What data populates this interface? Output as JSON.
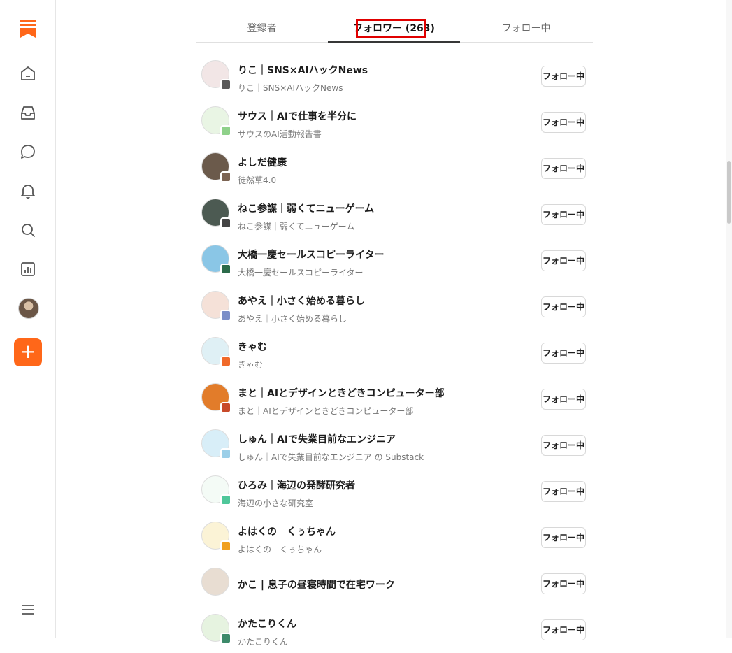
{
  "tabs": [
    {
      "label": "登録者"
    },
    {
      "label": "フォロワー (263)"
    },
    {
      "label": "フォロー中"
    }
  ],
  "colors": {
    "accent": "#ff6719",
    "highlight": "#e00000"
  },
  "icons": {
    "logo": "substack-logo-icon",
    "nav": [
      "home-icon",
      "inbox-icon",
      "chat-icon",
      "bell-icon",
      "search-icon",
      "stats-icon"
    ],
    "create": "plus-icon",
    "menu": "menu-icon"
  },
  "create_label": "+",
  "follow_label": "フォロー中",
  "followers": [
    {
      "name": "りこ｜SNS×AIハックNews",
      "sub": "りこ｜SNS×AIハックNews",
      "avatar_color": "#f2e6e6",
      "badge_color": "#5a5a5a"
    },
    {
      "name": "サウス｜AIで仕事を半分に",
      "sub": "サウスのAI活動報告書",
      "avatar_color": "#e9f5e4",
      "badge_color": "#8fd18a"
    },
    {
      "name": "よしだ健康",
      "sub": "徒然草4.0",
      "avatar_color": "#6b5a4b",
      "badge_color": "#7c6453"
    },
    {
      "name": "ねこ参謀｜弱くてニューゲーム",
      "sub": "ねこ参謀｜弱くてニューゲーム",
      "avatar_color": "#4c5a52",
      "badge_color": "#444"
    },
    {
      "name": "大橋一慶セールスコピーライター",
      "sub": "大橋一慶セールスコピーライター",
      "avatar_color": "#8ac6e6",
      "badge_color": "#2c6b4a"
    },
    {
      "name": "あやえ｜小さく始める暮らし",
      "sub": "あやえ｜小さく始める暮らし",
      "avatar_color": "#f5e1d8",
      "badge_color": "#7b8fc8"
    },
    {
      "name": "きゃむ",
      "sub": "きゃむ",
      "avatar_color": "#dff0f5",
      "badge_color": "#f06a2a"
    },
    {
      "name": "まと｜AIとデザインときどきコンピューター部",
      "sub": "まと｜AIとデザインときどきコンピューター部",
      "avatar_color": "#e27c2a",
      "badge_color": "#c84a2a"
    },
    {
      "name": "しゅん｜AIで失業目前なエンジニア",
      "sub": "しゅん｜AIで失業目前なエンジニア の Substack",
      "avatar_color": "#d8eef8",
      "badge_color": "#9ccfe8"
    },
    {
      "name": "ひろみ｜海辺の発酵研究者",
      "sub": "海辺の小さな研究室",
      "avatar_color": "#f4fbf6",
      "badge_color": "#4fc79a"
    },
    {
      "name": "よはくの　くぅちゃん",
      "sub": "よはくの　くぅちゃん",
      "avatar_color": "#fbf3d6",
      "badge_color": "#f0a020"
    },
    {
      "name": "かこ | 息子の昼寝時間で在宅ワーク",
      "sub": "",
      "avatar_color": "#e8ddd2",
      "badge_color": ""
    },
    {
      "name": "かたこりくん",
      "sub": "かたこりくん",
      "avatar_color": "#e6f3e0",
      "badge_color": "#3d8a6a"
    }
  ]
}
